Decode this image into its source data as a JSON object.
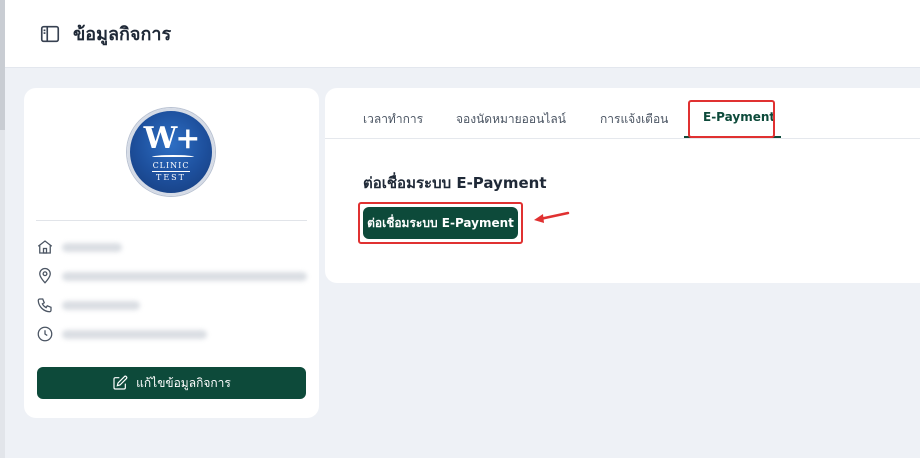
{
  "header": {
    "title": "ข้อมูลกิจการ",
    "icon": "book-open-icon"
  },
  "profile": {
    "logo": {
      "letters": "W+",
      "line1": "CLINIC",
      "line2": "TEST"
    },
    "info_rows": [
      {
        "icon": "home-icon"
      },
      {
        "icon": "map-pin-icon"
      },
      {
        "icon": "phone-icon"
      },
      {
        "icon": "clock-icon"
      }
    ],
    "edit_button_label": "แก้ไขข้อมูลกิจการ",
    "edit_button_icon": "edit-icon"
  },
  "tabs": [
    {
      "label": "เวลาทำการ",
      "active": false
    },
    {
      "label": "จองนัดหมายออนไลน์",
      "active": false
    },
    {
      "label": "การแจ้งเตือน",
      "active": false
    },
    {
      "label": "E-Payment",
      "active": true
    }
  ],
  "epayment": {
    "section_title": "ต่อเชื่อมระบบ E-Payment",
    "connect_button_label": "ต่อเชื่อมระบบ E-Payment"
  },
  "colors": {
    "primary": "#0d4a3a",
    "highlight": "#e03131",
    "background": "#eef1f6"
  }
}
